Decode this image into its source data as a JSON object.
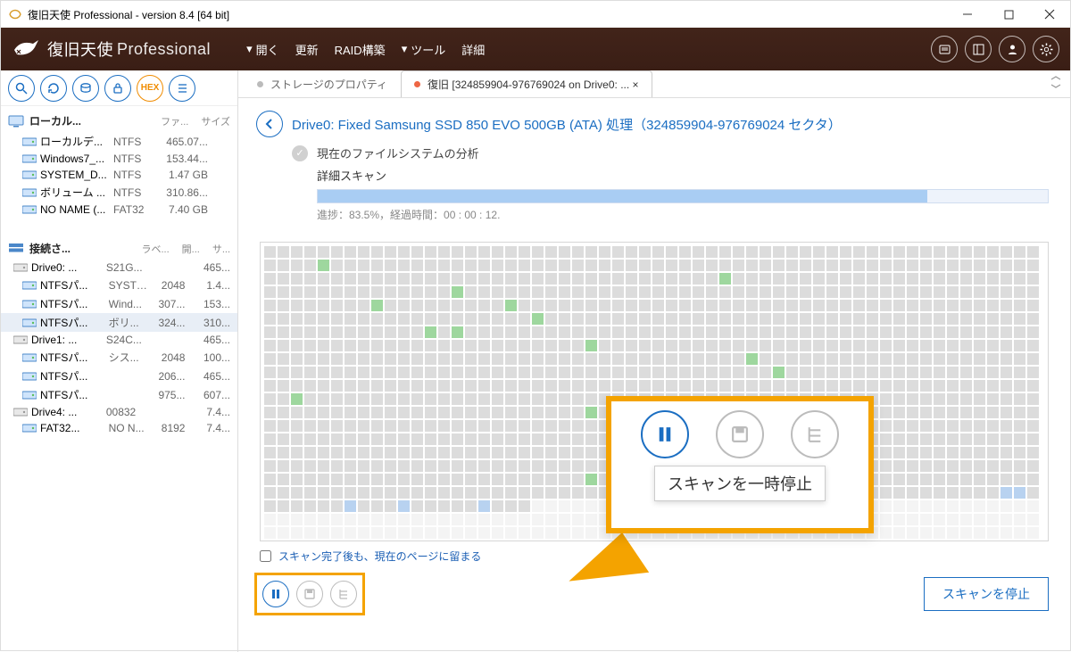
{
  "window": {
    "title": "復旧天使 Professional - version 8.4 [64 bit]"
  },
  "brand": {
    "part1": "復旧天使",
    "part2": "Professional"
  },
  "menu": {
    "open": "開く",
    "refresh": "更新",
    "raid": "RAID構築",
    "tools": "ツール",
    "detail": "詳細"
  },
  "sidebar": {
    "group1": {
      "title": "ローカル...",
      "cols": [
        "ファ...",
        "サイズ"
      ]
    },
    "vols": [
      {
        "name": "ローカルデ...",
        "fs": "NTFS",
        "size": "465.07..."
      },
      {
        "name": "Windows7_...",
        "fs": "NTFS",
        "size": "153.44..."
      },
      {
        "name": "SYSTEM_D...",
        "fs": "NTFS",
        "size": "1.47 GB"
      },
      {
        "name": "ボリューム ...",
        "fs": "NTFS",
        "size": "310.86..."
      },
      {
        "name": "NO NAME (...",
        "fs": "FAT32",
        "size": "7.40 GB"
      }
    ],
    "group2": {
      "title": "接続さ...",
      "cols": [
        "ラベ...",
        "開...",
        "サ..."
      ]
    },
    "drives": [
      {
        "name": "Drive0: ...",
        "c1": "S21G...",
        "c2": "",
        "c3": "465...",
        "part": false
      },
      {
        "name": "NTFSパ...",
        "c1": "SYSTE...",
        "c2": "2048",
        "c3": "1.4...",
        "part": true
      },
      {
        "name": "NTFSパ...",
        "c1": "Wind...",
        "c2": "307...",
        "c3": "153...",
        "part": true
      },
      {
        "name": "NTFSパ...",
        "c1": "ボリ...",
        "c2": "324...",
        "c3": "310...",
        "part": true,
        "sel": true
      },
      {
        "name": "Drive1: ...",
        "c1": "S24C...",
        "c2": "",
        "c3": "465...",
        "part": false
      },
      {
        "name": "NTFSパ...",
        "c1": "シス...",
        "c2": "2048",
        "c3": "100...",
        "part": true
      },
      {
        "name": "NTFSパ...",
        "c1": "",
        "c2": "206...",
        "c3": "465...",
        "part": true
      },
      {
        "name": "NTFSパ...",
        "c1": "",
        "c2": "975...",
        "c3": "607...",
        "part": true
      },
      {
        "name": "Drive4: ...",
        "c1": "00832",
        "c2": "",
        "c3": "7.4...",
        "part": false
      },
      {
        "name": "FAT32...",
        "c1": "NO N...",
        "c2": "8192",
        "c3": "7.4...",
        "part": true
      }
    ]
  },
  "tabs": {
    "t1": "ストレージのプロパティ",
    "t2": "復旧 [324859904-976769024 on Drive0: ... ×"
  },
  "detail": {
    "title": "Drive0: Fixed Samsung SSD 850 EVO 500GB (ATA) 処理（324859904-976769024 セクタ）",
    "step1": "現在のファイルシステムの分析",
    "step2": "詳細スキャン",
    "progress_pct": 83.5,
    "progress_text": "進捗：83.5%，経過時間：00 : 00 : 12."
  },
  "footer": {
    "stay": "スキャン完了後も、現在のページに留まる"
  },
  "buttons": {
    "stop": "スキャンを停止"
  },
  "callout": {
    "tooltip": "スキャンを一時停止"
  },
  "hex": "HEX"
}
